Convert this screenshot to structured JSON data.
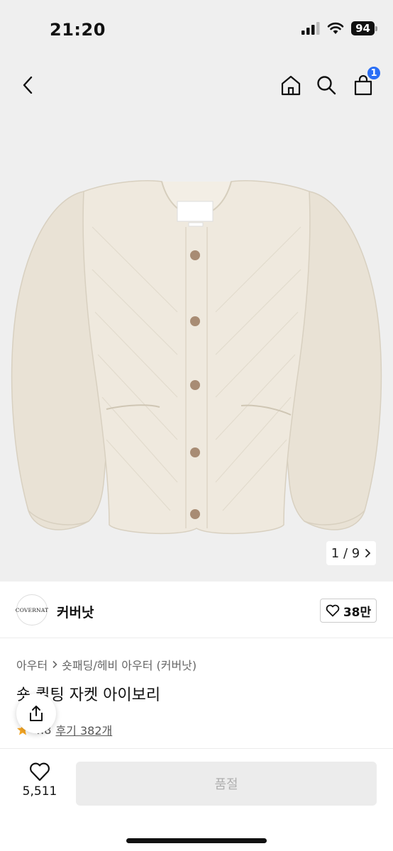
{
  "status_bar": {
    "time": "21:20",
    "battery": "94",
    "icons": [
      "signal-icon",
      "wifi-icon",
      "battery-icon"
    ]
  },
  "nav": {
    "icons": [
      "chevron-left-icon",
      "home-icon",
      "search-icon",
      "cart-icon"
    ],
    "cart_badge": "1"
  },
  "gallery": {
    "counter": "1 / 9"
  },
  "brand": {
    "logo_text": "COVERNAT",
    "name": "커버낫",
    "likes": "38만"
  },
  "product": {
    "breadcrumb": [
      "아우터",
      "숏패딩/헤비 아우터 (커버낫)"
    ],
    "title": "숏 퀼팅 자켓 아이보리",
    "rating": "4.8",
    "reviews": "후기 382개"
  },
  "bottom": {
    "wish_count": "5,511",
    "buy_label": "품절"
  },
  "colors": {
    "accent": "#2a6ef5",
    "star": "#f5a623",
    "jacket": "#ece6da"
  }
}
